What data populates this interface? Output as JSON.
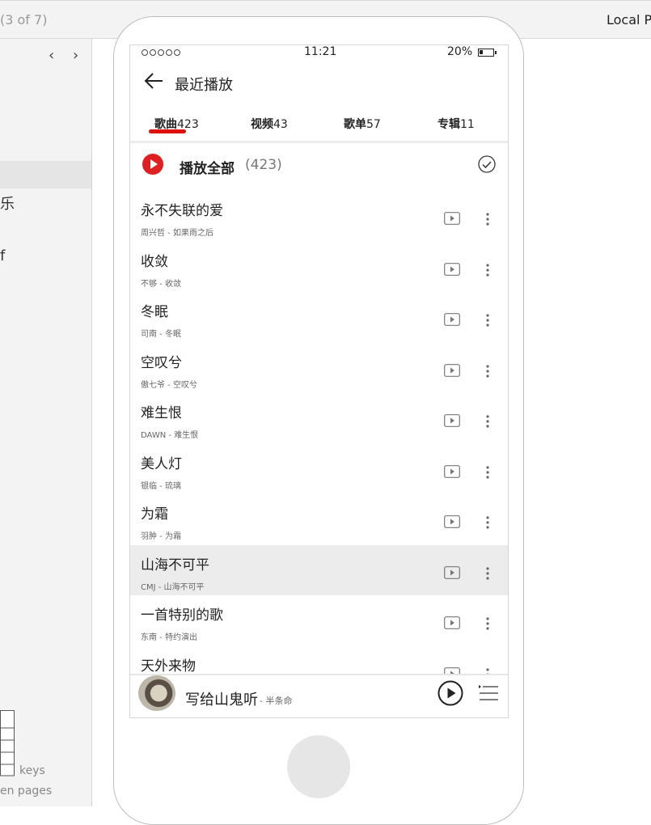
{
  "browser": {
    "page_indicator": "(3 of 7)",
    "right_label": "Local Pr"
  },
  "left_panel": {
    "nav_prev_icon": "chevron-left-icon",
    "nav_next_icon": "chevron-right-icon",
    "fragment_1": "乐",
    "fragment_2": "f",
    "keys_label": "keys",
    "pages_label": "en pages"
  },
  "status_bar": {
    "time": "11:21",
    "battery": "20%"
  },
  "header": {
    "back_icon": "arrow-left-icon",
    "title": "最近播放"
  },
  "tabs": [
    {
      "name": "歌曲",
      "count": "423",
      "active": true
    },
    {
      "name": "视频",
      "count": "43",
      "active": false
    },
    {
      "name": "歌单",
      "count": "57",
      "active": false
    },
    {
      "name": "专辑",
      "count": "11",
      "active": false
    }
  ],
  "play_all": {
    "label": "播放全部",
    "count": "(423)"
  },
  "songs": [
    {
      "title": "永不失联的爱",
      "subtitle": "周兴哲 - 如果雨之后"
    },
    {
      "title": "收敛",
      "subtitle": "不够 - 收敛"
    },
    {
      "title": "冬眠",
      "subtitle": "司南 - 冬眠"
    },
    {
      "title": "空叹兮",
      "subtitle": "傲七爷 - 空叹兮"
    },
    {
      "title": "难生恨",
      "subtitle": "DAWN - 难生恨"
    },
    {
      "title": "美人灯",
      "subtitle": "银临 - 琉璃"
    },
    {
      "title": "为霜",
      "subtitle": "羽肿 - 为霜"
    },
    {
      "title": "山海不可平",
      "subtitle": "CMJ - 山海不可平",
      "highlighted": true
    },
    {
      "title": "一首特别的歌",
      "subtitle": "东南 - 特约演出"
    },
    {
      "title": "天外来物",
      "subtitle": ""
    }
  ],
  "player": {
    "title": "写给山鬼听",
    "subtitle": "- 半条命"
  },
  "colors": {
    "accent": "#e02020",
    "highlight": "#ececec",
    "panel": "#f3f3f3"
  }
}
